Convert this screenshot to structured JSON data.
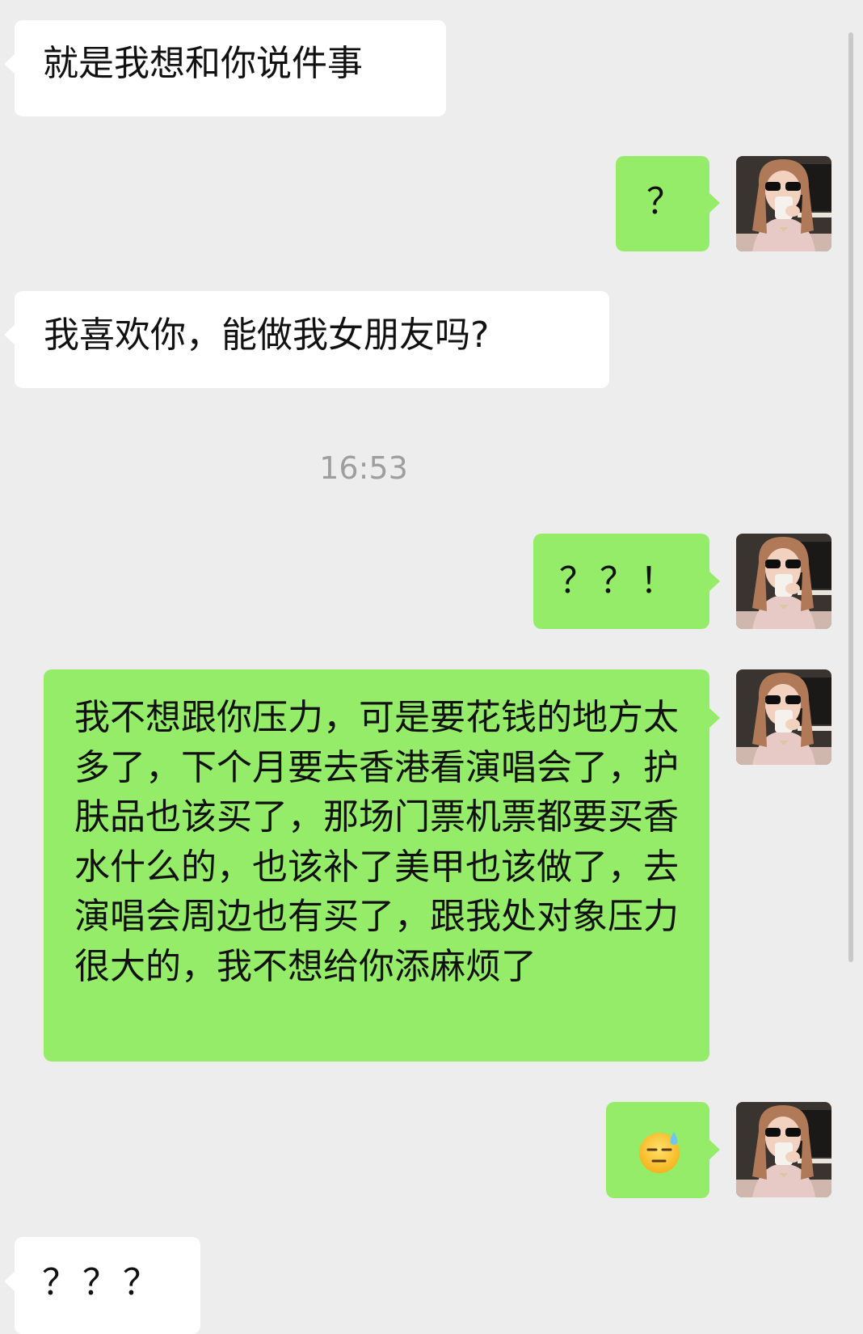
{
  "messages": [
    {
      "side": "left",
      "text": "就是我想和你说件事"
    },
    {
      "side": "right",
      "text": "？"
    },
    {
      "side": "left",
      "text": "我喜欢你，能做我女朋友吗?"
    },
    {
      "side": "right",
      "text": "？？！"
    },
    {
      "side": "right",
      "text": "我不想跟你压力，可是要花钱的地方太多了，下个月要去香港看演唱会了，护肤品也该买了，那场门票机票都要买香水什么的，也该补了美甲也该做了，去演唱会周边也有买了，跟我处对象压力很大的，我不想给你添麻烦了"
    },
    {
      "side": "right",
      "emoji": "cold-sweat-face-emoji"
    },
    {
      "side": "left",
      "text": "？？？"
    }
  ],
  "timestamp": "16:53",
  "colors": {
    "background": "#ededed",
    "incoming": "#ffffff",
    "outgoing": "#95ec69",
    "timestamp": "#9e9e9e"
  },
  "avatar_icon": "user-avatar-photo"
}
